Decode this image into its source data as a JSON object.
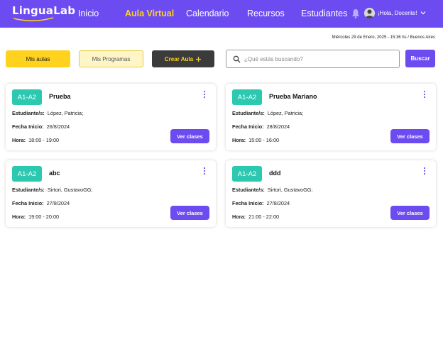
{
  "header": {
    "logo": "LinguaLab",
    "nav": [
      {
        "label": "Inicio",
        "active": false
      },
      {
        "label": "Aula Virtual",
        "active": true
      },
      {
        "label": "Calendario",
        "active": false
      },
      {
        "label": "Recursos",
        "active": false
      },
      {
        "label": "Estudiantes",
        "active": false
      }
    ],
    "greeting": "¡Hola, Docente!",
    "icons": [
      "bell-icon",
      "avatar",
      "chevron-down-icon"
    ]
  },
  "datetime": "Miércoles 29 de Enero, 2025 - 15:36 hs / Buenos Aires",
  "toolbar": {
    "mis_aulas": "Mis aulas",
    "mis_programas": "Mis Programas",
    "crear_aula": "Crear Aula",
    "search_placeholder": "¿Qué estás buscando?",
    "buscar": "Buscar"
  },
  "labels": {
    "estudiantes": "Estudiante/s:",
    "fecha_inicio": "Fecha Inicio:",
    "hora": "Hora:",
    "ver_clases": "Ver clases"
  },
  "cards": [
    {
      "level": "A1-A2",
      "name": "Prueba",
      "students": "López, Patricia;",
      "start_date": "26/8/2024",
      "time": "18:00 - 19:00"
    },
    {
      "level": "A1-A2",
      "name": "Prueba Mariano",
      "students": "López, Patricia;",
      "start_date": "28/8/2024",
      "time": "15:00 - 16:00"
    },
    {
      "level": "A1-A2",
      "name": "abc",
      "students": "Sirtori, GustavoGG;",
      "start_date": "27/8/2024",
      "time": "19:00 - 20:00"
    },
    {
      "level": "A1-A2",
      "name": "ddd",
      "students": "Sirtori, GustavoGG;",
      "start_date": "27/8/2024",
      "time": "21:00 - 22:00"
    }
  ],
  "colors": {
    "primary": "#6c4cf1",
    "accent_yellow": "#ffd21e",
    "level_badge": "#2cc9b0",
    "dark_button": "#3b3b3b"
  }
}
